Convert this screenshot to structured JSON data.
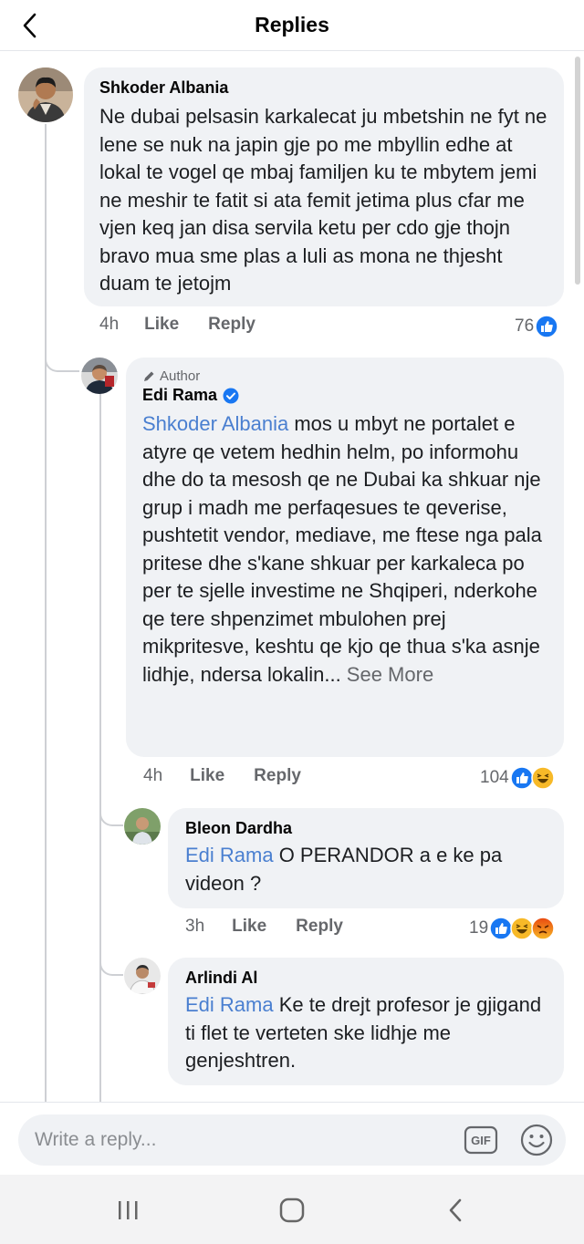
{
  "header": {
    "title": "Replies",
    "back_icon": "chevron-left-icon"
  },
  "comments": [
    {
      "name": "Shkoder Albania",
      "text": "Ne dubai pelsasin karkalecat ju mbetshin ne fyt ne lene se nuk na japin gje po me mbyllin edhe at lokal te vogel qe mbaj familjen ku te mbytem jemi ne meshir te fatit si ata femit jetima plus cfar me  vjen keq jan disa servila ketu per cdo gje thojn bravo mua sme plas a luli as mona ne thjesht duam te jetojm",
      "time": "4h",
      "like": "Like",
      "reply": "Reply",
      "reaction_count": "76",
      "reactions": [
        "like"
      ]
    },
    {
      "author_tag": "Author",
      "name": "Edi Rama",
      "verified": true,
      "mention": "Shkoder Albania",
      "text": " mos u mbyt ne portalet e atyre qe vetem hedhin helm, po informohu dhe do ta mesosh qe ne Dubai ka shkuar nje grup i madh me perfaqesues te qeverise, pushtetit vendor, mediave, me ftese nga pala pritese dhe s'kane shkuar per karkaleca po per te sjelle investime ne Shqiperi, nderkohe qe tere shpenzimet mbulohen prej mikpritesve, keshtu qe kjo qe thua s'ka asnje lidhje, ndersa lokalin...",
      "see_more": " See More",
      "time": "4h",
      "like": "Like",
      "reply": "Reply",
      "reaction_count": "104",
      "reactions": [
        "like",
        "haha"
      ]
    },
    {
      "name": "Bleon Dardha",
      "mention": "Edi Rama",
      "text": " O PERANDOR a e ke pa videon ?",
      "time": "3h",
      "like": "Like",
      "reply": "Reply",
      "reaction_count": "19",
      "reactions": [
        "like",
        "haha",
        "angry"
      ]
    },
    {
      "name": "Arlindi Al",
      "mention": "Edi Rama",
      "text": " Ke te drejt profesor je gjigand ti flet te verteten ske lidhje me genjeshtren."
    }
  ],
  "composer": {
    "placeholder": "Write a reply...",
    "gif_label": "GIF"
  },
  "navbar": {
    "icons": [
      "recent-apps-icon",
      "home-icon",
      "back-icon"
    ]
  },
  "colors": {
    "like_blue": "#1877f2",
    "haha_yellow": "#f7b928",
    "angry_orange": "#e9710f",
    "mention": "#4a7fd0"
  }
}
